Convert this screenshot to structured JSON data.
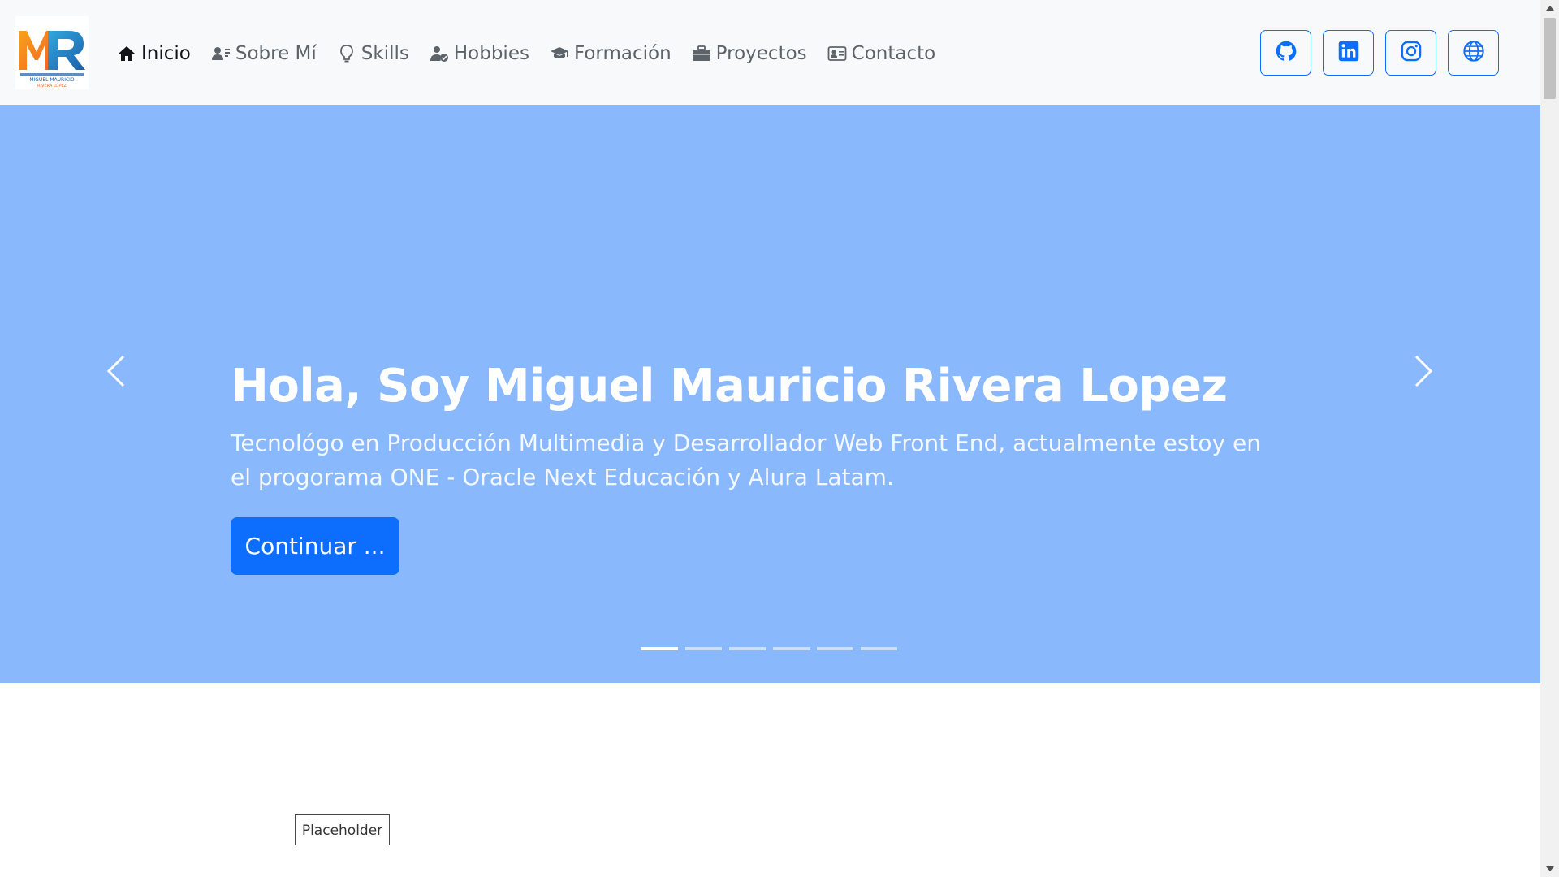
{
  "logo": {
    "alt": "MR",
    "line1": "MIGUEL MAURICIO",
    "line2": "RIVERA LÓPEZ"
  },
  "nav": {
    "items": [
      {
        "label": "Inicio",
        "icon": "home-icon",
        "active": true
      },
      {
        "label": "Sobre Mí",
        "icon": "user-card-icon"
      },
      {
        "label": "Skills",
        "icon": "lightbulb-icon"
      },
      {
        "label": "Hobbies",
        "icon": "user-check-icon"
      },
      {
        "label": "Formación",
        "icon": "graduation-cap-icon"
      },
      {
        "label": "Proyectos",
        "icon": "briefcase-icon"
      },
      {
        "label": "Contacto",
        "icon": "contact-card-icon"
      }
    ]
  },
  "social": [
    {
      "icon": "github-icon"
    },
    {
      "icon": "linkedin-icon"
    },
    {
      "icon": "instagram-icon"
    },
    {
      "icon": "globe-icon"
    }
  ],
  "hero": {
    "title": "Hola, Soy Miguel Mauricio Rivera Lopez",
    "subtitle": "Tecnológo en Producción Multimedia y Desarrollador Web Front End, actualmente estoy en el progorama ONE - Oracle Next Educación y Alura Latam.",
    "cta_label": "Continuar ...",
    "indicator_count": 6,
    "active_indicator": 1
  },
  "placeholder": {
    "label": "Placeholder"
  },
  "colors": {
    "accent": "#0d6efd",
    "hero_bg": "#8ab8fc",
    "navbar_bg": "#f8f9fa"
  }
}
